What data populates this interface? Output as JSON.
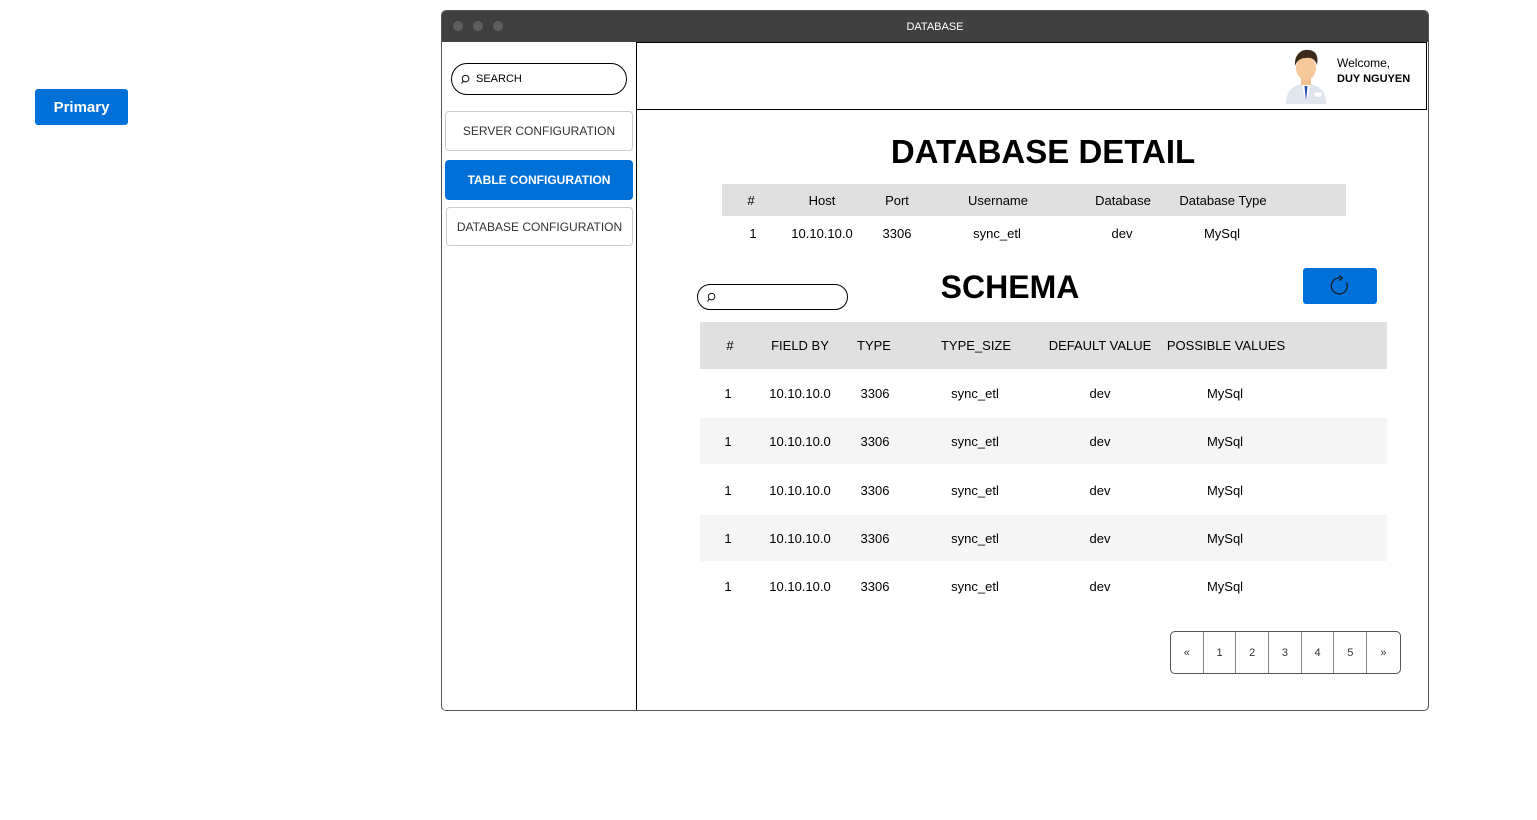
{
  "primary_button": {
    "label": "Primary"
  },
  "window": {
    "title": "DATABASE"
  },
  "sidebar": {
    "search_label": "SEARCH",
    "items": [
      {
        "label": "SERVER CONFIGURATION",
        "active": false
      },
      {
        "label": "TABLE CONFIGURATION",
        "active": true
      },
      {
        "label": "DATABASE CONFIGURATION",
        "active": false
      }
    ]
  },
  "header": {
    "welcome": "Welcome,",
    "user_name": "DUY NGUYEN"
  },
  "detail": {
    "title": "DATABASE DETAIL",
    "columns": [
      "#",
      "Host",
      "Port",
      "Username",
      "Database",
      "Database Type"
    ],
    "row": [
      "1",
      "10.10.10.0",
      "3306",
      "sync_etl",
      "dev",
      "MySql"
    ]
  },
  "schema": {
    "title": "SCHEMA",
    "search_placeholder": "",
    "columns": [
      "#",
      "FIELD BY",
      "TYPE",
      "TYPE_SIZE",
      "DEFAULT VALUE",
      "POSSIBLE VALUES"
    ],
    "rows": [
      [
        "1",
        "10.10.10.0",
        "3306",
        "sync_etl",
        "dev",
        "MySql"
      ],
      [
        "1",
        "10.10.10.0",
        "3306",
        "sync_etl",
        "dev",
        "MySql"
      ],
      [
        "1",
        "10.10.10.0",
        "3306",
        "sync_etl",
        "dev",
        "MySql"
      ],
      [
        "1",
        "10.10.10.0",
        "3306",
        "sync_etl",
        "dev",
        "MySql"
      ],
      [
        "1",
        "10.10.10.0",
        "3306",
        "sync_etl",
        "dev",
        "MySql"
      ]
    ]
  },
  "pagination": {
    "first": "«",
    "pages": [
      "1",
      "2",
      "3",
      "4",
      "5"
    ],
    "last": "»"
  },
  "colors": {
    "accent": "#0070d9",
    "titlebar": "#404040",
    "header_bg": "#e0e0e0",
    "stripe_bg": "#f5f5f5"
  },
  "icons": {
    "search": "search-icon",
    "refresh": "refresh-icon",
    "avatar": "user-avatar"
  }
}
